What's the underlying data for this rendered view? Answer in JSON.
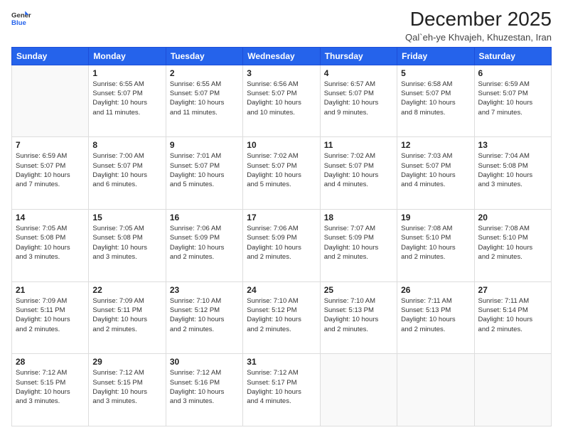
{
  "header": {
    "logo_line1": "General",
    "logo_line2": "Blue",
    "month_title": "December 2025",
    "location": "Qal`eh-ye Khvajeh, Khuzestan, Iran"
  },
  "days_of_week": [
    "Sunday",
    "Monday",
    "Tuesday",
    "Wednesday",
    "Thursday",
    "Friday",
    "Saturday"
  ],
  "weeks": [
    [
      {
        "day": "",
        "info": ""
      },
      {
        "day": "1",
        "info": "Sunrise: 6:55 AM\nSunset: 5:07 PM\nDaylight: 10 hours\nand 11 minutes."
      },
      {
        "day": "2",
        "info": "Sunrise: 6:55 AM\nSunset: 5:07 PM\nDaylight: 10 hours\nand 11 minutes."
      },
      {
        "day": "3",
        "info": "Sunrise: 6:56 AM\nSunset: 5:07 PM\nDaylight: 10 hours\nand 10 minutes."
      },
      {
        "day": "4",
        "info": "Sunrise: 6:57 AM\nSunset: 5:07 PM\nDaylight: 10 hours\nand 9 minutes."
      },
      {
        "day": "5",
        "info": "Sunrise: 6:58 AM\nSunset: 5:07 PM\nDaylight: 10 hours\nand 8 minutes."
      },
      {
        "day": "6",
        "info": "Sunrise: 6:59 AM\nSunset: 5:07 PM\nDaylight: 10 hours\nand 7 minutes."
      }
    ],
    [
      {
        "day": "7",
        "info": "Sunrise: 6:59 AM\nSunset: 5:07 PM\nDaylight: 10 hours\nand 7 minutes."
      },
      {
        "day": "8",
        "info": "Sunrise: 7:00 AM\nSunset: 5:07 PM\nDaylight: 10 hours\nand 6 minutes."
      },
      {
        "day": "9",
        "info": "Sunrise: 7:01 AM\nSunset: 5:07 PM\nDaylight: 10 hours\nand 5 minutes."
      },
      {
        "day": "10",
        "info": "Sunrise: 7:02 AM\nSunset: 5:07 PM\nDaylight: 10 hours\nand 5 minutes."
      },
      {
        "day": "11",
        "info": "Sunrise: 7:02 AM\nSunset: 5:07 PM\nDaylight: 10 hours\nand 4 minutes."
      },
      {
        "day": "12",
        "info": "Sunrise: 7:03 AM\nSunset: 5:07 PM\nDaylight: 10 hours\nand 4 minutes."
      },
      {
        "day": "13",
        "info": "Sunrise: 7:04 AM\nSunset: 5:08 PM\nDaylight: 10 hours\nand 3 minutes."
      }
    ],
    [
      {
        "day": "14",
        "info": "Sunrise: 7:05 AM\nSunset: 5:08 PM\nDaylight: 10 hours\nand 3 minutes."
      },
      {
        "day": "15",
        "info": "Sunrise: 7:05 AM\nSunset: 5:08 PM\nDaylight: 10 hours\nand 3 minutes."
      },
      {
        "day": "16",
        "info": "Sunrise: 7:06 AM\nSunset: 5:09 PM\nDaylight: 10 hours\nand 2 minutes."
      },
      {
        "day": "17",
        "info": "Sunrise: 7:06 AM\nSunset: 5:09 PM\nDaylight: 10 hours\nand 2 minutes."
      },
      {
        "day": "18",
        "info": "Sunrise: 7:07 AM\nSunset: 5:09 PM\nDaylight: 10 hours\nand 2 minutes."
      },
      {
        "day": "19",
        "info": "Sunrise: 7:08 AM\nSunset: 5:10 PM\nDaylight: 10 hours\nand 2 minutes."
      },
      {
        "day": "20",
        "info": "Sunrise: 7:08 AM\nSunset: 5:10 PM\nDaylight: 10 hours\nand 2 minutes."
      }
    ],
    [
      {
        "day": "21",
        "info": "Sunrise: 7:09 AM\nSunset: 5:11 PM\nDaylight: 10 hours\nand 2 minutes."
      },
      {
        "day": "22",
        "info": "Sunrise: 7:09 AM\nSunset: 5:11 PM\nDaylight: 10 hours\nand 2 minutes."
      },
      {
        "day": "23",
        "info": "Sunrise: 7:10 AM\nSunset: 5:12 PM\nDaylight: 10 hours\nand 2 minutes."
      },
      {
        "day": "24",
        "info": "Sunrise: 7:10 AM\nSunset: 5:12 PM\nDaylight: 10 hours\nand 2 minutes."
      },
      {
        "day": "25",
        "info": "Sunrise: 7:10 AM\nSunset: 5:13 PM\nDaylight: 10 hours\nand 2 minutes."
      },
      {
        "day": "26",
        "info": "Sunrise: 7:11 AM\nSunset: 5:13 PM\nDaylight: 10 hours\nand 2 minutes."
      },
      {
        "day": "27",
        "info": "Sunrise: 7:11 AM\nSunset: 5:14 PM\nDaylight: 10 hours\nand 2 minutes."
      }
    ],
    [
      {
        "day": "28",
        "info": "Sunrise: 7:12 AM\nSunset: 5:15 PM\nDaylight: 10 hours\nand 3 minutes."
      },
      {
        "day": "29",
        "info": "Sunrise: 7:12 AM\nSunset: 5:15 PM\nDaylight: 10 hours\nand 3 minutes."
      },
      {
        "day": "30",
        "info": "Sunrise: 7:12 AM\nSunset: 5:16 PM\nDaylight: 10 hours\nand 3 minutes."
      },
      {
        "day": "31",
        "info": "Sunrise: 7:12 AM\nSunset: 5:17 PM\nDaylight: 10 hours\nand 4 minutes."
      },
      {
        "day": "",
        "info": ""
      },
      {
        "day": "",
        "info": ""
      },
      {
        "day": "",
        "info": ""
      }
    ]
  ]
}
